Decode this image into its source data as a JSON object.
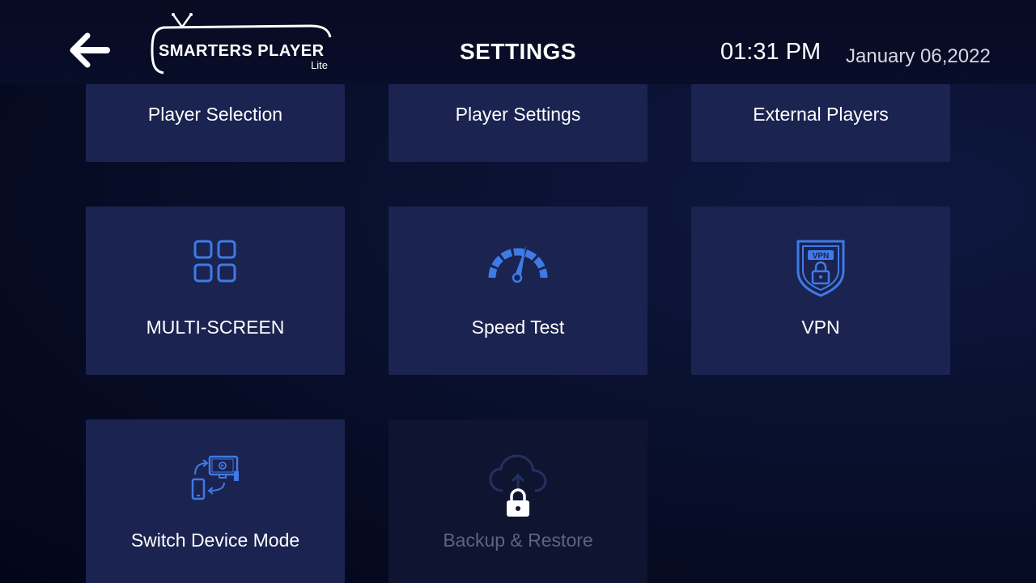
{
  "header": {
    "logo": {
      "brand": "SMARTERS PLAYER",
      "edition": "Lite"
    },
    "title": "SETTINGS",
    "time": "01:31 PM",
    "date": "January 06,2022"
  },
  "tiles": [
    {
      "label": "Player Selection",
      "icon": "none"
    },
    {
      "label": "Player Settings",
      "icon": "none"
    },
    {
      "label": "External Players",
      "icon": "none"
    },
    {
      "label": "MULTI-SCREEN",
      "icon": "multi-screen-grid-icon"
    },
    {
      "label": "Speed Test",
      "icon": "speedometer-icon"
    },
    {
      "label": "VPN",
      "icon": "vpn-shield-lock-icon"
    },
    {
      "label": "Switch Device Mode",
      "icon": "device-switch-icon"
    },
    {
      "label": "Backup & Restore",
      "icon": "cloud-lock-icon",
      "locked": true
    }
  ],
  "colors": {
    "accent": "#3e7be6",
    "tile": "#1b2350",
    "tile_disabled": "#0f1530",
    "background": "#060b22"
  }
}
